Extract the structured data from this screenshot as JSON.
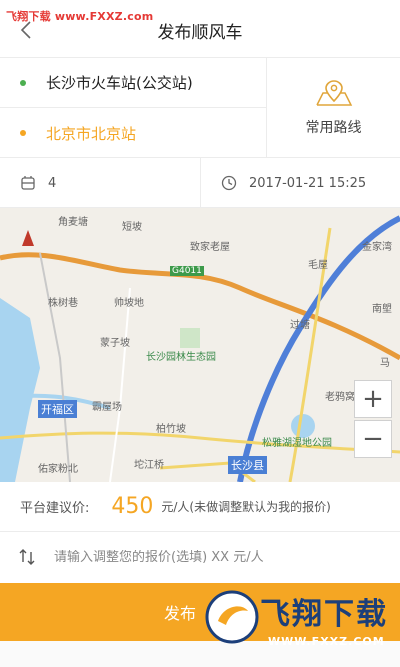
{
  "watermark": {
    "top_text": "飞翔下载 www.FXXZ.com",
    "logo_title": "飞翔下载",
    "logo_url": "WWW.FXXZ.COM"
  },
  "header": {
    "title": "发布顺风车",
    "back_icon": "chevron-left-icon"
  },
  "route": {
    "start": "长沙市火车站(公交站)",
    "end": "北京市北京站",
    "common_route_label": "常用路线",
    "start_dot_color": "#4caf50",
    "end_color": "#f5a623"
  },
  "trip": {
    "seats": "4",
    "datetime": "2017-01-21 15:25"
  },
  "map": {
    "labels": {
      "jiaomai": "角麦塘",
      "duanpo": "短坡",
      "zhenjiaolaowu": "致家老屋",
      "jinjiawan": "金家湾",
      "g4011": "G4011",
      "maowu": "毛屋",
      "zhushuxiang": "株树巷",
      "shuaipo": "帅坡地",
      "nanxiang": "南塱",
      "guotang": "过塘",
      "zongpo": "蒙子坡",
      "gongyuan": "长沙园林生态园",
      "ma": "马",
      "kaifu": "开福区",
      "fupingchang": "霸屋场",
      "laoyawo": "老鸦窝",
      "baizhupo": "柏竹坡",
      "songyahu": "松雅湖湿地公园",
      "zhangjiazi": "佑家粉北",
      "changshaxian": "长沙县",
      "tuojiang": "坨江桥"
    },
    "zoom_in": "+",
    "zoom_out": "−"
  },
  "price": {
    "label": "平台建议价:",
    "value": "450",
    "unit_note": "元/人(未做调整默认为我的报价)"
  },
  "offer_input": {
    "placeholder": "请输入调整您的报价(选填) XX 元/人"
  },
  "publish": {
    "label": "发布"
  },
  "colors": {
    "accent": "#f5a623",
    "divider": "#ececec"
  }
}
